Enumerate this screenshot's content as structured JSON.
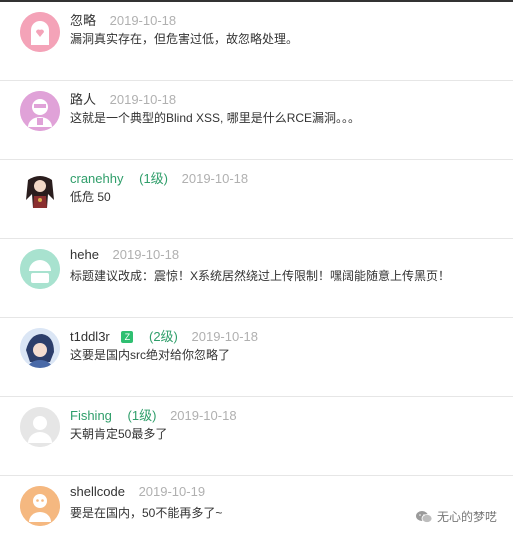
{
  "comments": [
    {
      "name": "忽略",
      "level": "",
      "badge": "",
      "date": "2019-10-18",
      "text": "漏洞真实存在，但危害过低，故忽略处理。",
      "avatar": "pink-avatar-icon",
      "color": "#f4a3b8"
    },
    {
      "name": "路人",
      "level": "",
      "badge": "",
      "date": "2019-10-18",
      "text": "这就是一个典型的Blind XSS, 哪里是什么RCE漏洞。。。",
      "avatar": "purple-avatar-icon",
      "color": "#e0a2d8"
    },
    {
      "name": "cranehhy",
      "level": "(1级)",
      "badge": "",
      "date": "2019-10-18",
      "text": "低危 50",
      "avatar": "character-avatar-icon",
      "color": "#7b3a3a"
    },
    {
      "name": "hehe",
      "level": "",
      "badge": "",
      "date": "2019-10-18",
      "text": "标题建议改成：震惊！X系统居然绕过上传限制！嘿阔能随意上传黑页！",
      "avatar": "teal-avatar-icon",
      "color": "#a8e2cf"
    },
    {
      "name": "t1ddl3r",
      "level": "(2级)",
      "badge": "Z",
      "date": "2019-10-18",
      "text": "这要是国内src绝对给你忽略了",
      "avatar": "anime-avatar-icon",
      "color": "#6d86b4"
    },
    {
      "name": "Fishing",
      "level": "(1级)",
      "badge": "",
      "date": "2019-10-18",
      "text": "天朝肯定50最多了",
      "avatar": "gray-avatar-icon",
      "color": "#d7d7d7"
    },
    {
      "name": "shellcode",
      "level": "",
      "badge": "",
      "date": "2019-10-19",
      "text": "要是在国内，50不能再多了~",
      "avatar": "orange-avatar-icon",
      "color": "#f5b880"
    }
  ],
  "watermark": {
    "text": "无心的梦呓",
    "icon": "wechat-icon"
  },
  "colors": {
    "green": "#2f9e6a",
    "date": "#b0b0b0",
    "divider": "#e6e6e6"
  }
}
